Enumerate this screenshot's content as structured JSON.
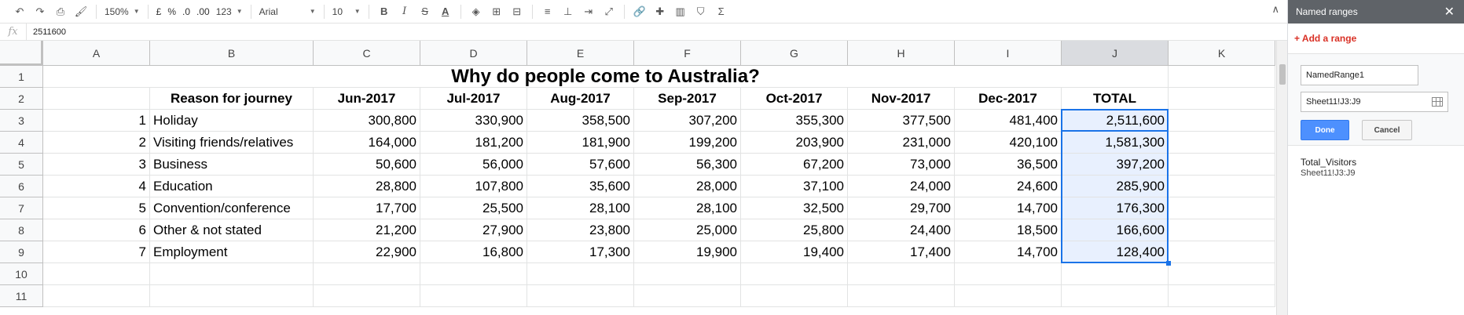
{
  "toolbar": {
    "zoom": "150%",
    "currency": "£",
    "percent": "%",
    "dec_less": ".0",
    "dec_more": ".00",
    "format_more": "123",
    "font": "Arial",
    "font_size": "10"
  },
  "formula_bar": {
    "fx": "fx",
    "value": "2511600"
  },
  "columns": [
    "A",
    "B",
    "C",
    "D",
    "E",
    "F",
    "G",
    "H",
    "I",
    "J",
    "K"
  ],
  "rows": [
    "1",
    "2",
    "3",
    "4",
    "5",
    "6",
    "7",
    "8",
    "9",
    "10",
    "11"
  ],
  "sheet": {
    "title": "Why do people come to Australia?",
    "header": [
      "",
      "Reason for journey",
      "Jun-2017",
      "Jul-2017",
      "Aug-2017",
      "Sep-2017",
      "Oct-2017",
      "Nov-2017",
      "Dec-2017",
      "TOTAL"
    ],
    "data": [
      [
        "1",
        "Holiday",
        "300,800",
        "330,900",
        "358,500",
        "307,200",
        "355,300",
        "377,500",
        "481,400",
        "2,511,600"
      ],
      [
        "2",
        "Visiting friends/relatives",
        "164,000",
        "181,200",
        "181,900",
        "199,200",
        "203,900",
        "231,000",
        "420,100",
        "1,581,300"
      ],
      [
        "3",
        "Business",
        "50,600",
        "56,000",
        "57,600",
        "56,300",
        "67,200",
        "73,000",
        "36,500",
        "397,200"
      ],
      [
        "4",
        "Education",
        "28,800",
        "107,800",
        "35,600",
        "28,000",
        "37,100",
        "24,000",
        "24,600",
        "285,900"
      ],
      [
        "5",
        "Convention/conference",
        "17,700",
        "25,500",
        "28,100",
        "28,100",
        "32,500",
        "29,700",
        "14,700",
        "176,300"
      ],
      [
        "6",
        "Other & not stated",
        "21,200",
        "27,900",
        "23,800",
        "25,000",
        "25,800",
        "24,400",
        "18,500",
        "166,600"
      ],
      [
        "7",
        "Employment",
        "22,900",
        "16,800",
        "17,300",
        "19,900",
        "19,400",
        "17,400",
        "14,700",
        "128,400"
      ]
    ]
  },
  "panel": {
    "title": "Named ranges",
    "add_label": "+ Add a range",
    "name_value": "NamedRange1",
    "range_value": "Sheet11!J3:J9",
    "done_label": "Done",
    "cancel_label": "Cancel",
    "items": [
      {
        "name": "Total_Visitors",
        "ref": "Sheet11!J3:J9"
      }
    ]
  },
  "colors": {
    "accent": "#1a73e8",
    "done": "#4d90fe",
    "add": "#d93025",
    "selection_fill": "#e8f0fe"
  }
}
